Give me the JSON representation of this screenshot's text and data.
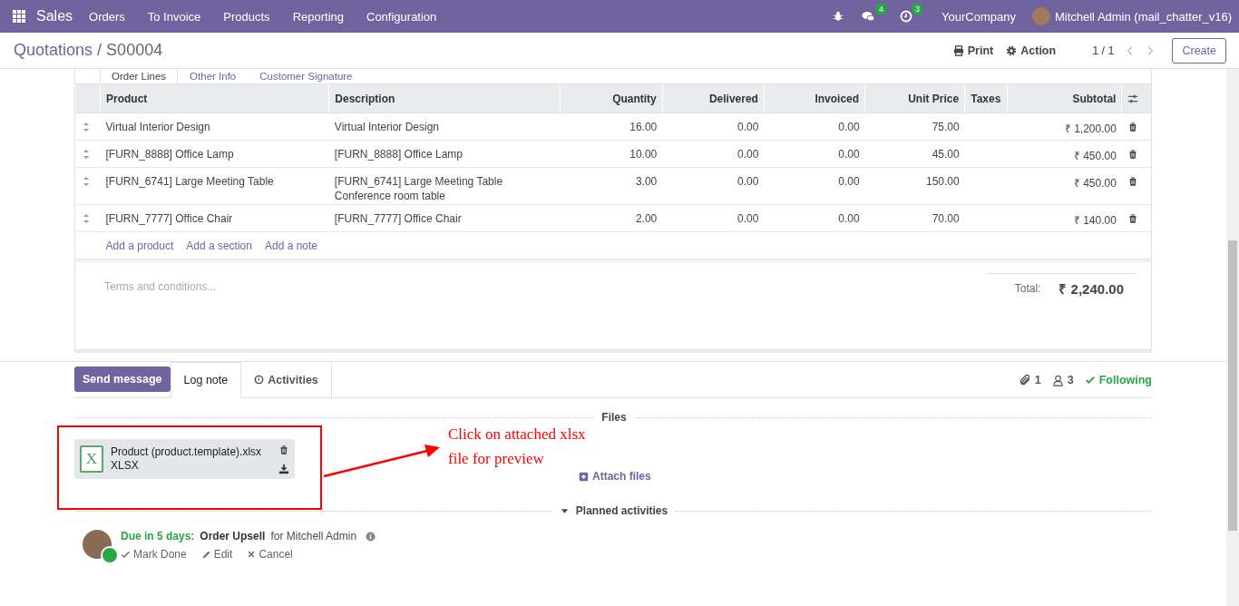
{
  "navbar": {
    "app_name": "Sales",
    "menu": [
      "Orders",
      "To Invoice",
      "Products",
      "Reporting",
      "Configuration"
    ],
    "messages_badge": "4",
    "activities_badge": "3",
    "company": "YourCompany",
    "user": "Mitchell Admin (mail_chatter_v16)"
  },
  "breadcrumb": {
    "parent": "Quotations",
    "separator": "/",
    "current": "S00004"
  },
  "control_panel": {
    "print": "Print",
    "action": "Action",
    "pager": "1 / 1",
    "create": "Create"
  },
  "tabs": [
    {
      "label": "Order Lines",
      "selected": true
    },
    {
      "label": "Other Info",
      "selected": false
    },
    {
      "label": "Customer Signature",
      "selected": false
    }
  ],
  "table": {
    "columns": [
      {
        "label": "Product",
        "kind": "text"
      },
      {
        "label": "Description",
        "kind": "text"
      },
      {
        "label": "Quantity",
        "kind": "number"
      },
      {
        "label": "Delivered",
        "kind": "number"
      },
      {
        "label": "Invoiced",
        "kind": "number"
      },
      {
        "label": "Unit Price",
        "kind": "number"
      },
      {
        "label": "Taxes",
        "kind": "text"
      },
      {
        "label": "Subtotal",
        "kind": "number"
      }
    ],
    "rows": [
      {
        "product": "Virtual Interior Design",
        "description": [
          "Virtual Interior Design"
        ],
        "quantity": "16.00",
        "delivered": "0.00",
        "invoiced": "0.00",
        "unit_price": "75.00",
        "subtotal": "₹ 1,200.00"
      },
      {
        "product": "[FURN_8888] Office Lamp",
        "description": [
          "[FURN_8888] Office Lamp"
        ],
        "quantity": "10.00",
        "delivered": "0.00",
        "invoiced": "0.00",
        "unit_price": "45.00",
        "subtotal": "₹ 450.00"
      },
      {
        "product": "[FURN_6741] Large Meeting Table",
        "description": [
          "[FURN_6741] Large Meeting Table",
          "Conference room table"
        ],
        "quantity": "3.00",
        "delivered": "0.00",
        "invoiced": "0.00",
        "unit_price": "150.00",
        "subtotal": "₹ 450.00"
      },
      {
        "product": "[FURN_7777] Office Chair",
        "description": [
          "[FURN_7777] Office Chair"
        ],
        "quantity": "2.00",
        "delivered": "0.00",
        "invoiced": "0.00",
        "unit_price": "70.00",
        "subtotal": "₹ 140.00"
      }
    ],
    "add_links": [
      "Add a product",
      "Add a section",
      "Add a note"
    ]
  },
  "terms": {
    "placeholder": "Terms and conditions..."
  },
  "total": {
    "label": "Total:",
    "value": "₹ 2,240.00"
  },
  "chatter": {
    "buttons": [
      {
        "label": "Send message",
        "kind": "primary",
        "selected": false
      },
      {
        "label": "Log note",
        "kind": "tab",
        "selected": true
      },
      {
        "label": "Activities",
        "kind": "activities",
        "selected": false
      }
    ],
    "attachments_count": "1",
    "followers_count": "3",
    "following": "Following",
    "files_heading": "Files",
    "attachment": {
      "icon_letter": "X",
      "name": "Product (product.template).xlsx",
      "type": "XLSX"
    },
    "attach_files": "Attach files",
    "planned_heading": "Planned activities",
    "activity": {
      "due": "Due in 5 days:",
      "summary": "Order Upsell",
      "assignee": "for Mitchell Admin",
      "actions": [
        "Mark Done",
        "Edit",
        "Cancel"
      ]
    }
  },
  "annotation": {
    "text": "Click on attached xlsx file for preview"
  }
}
